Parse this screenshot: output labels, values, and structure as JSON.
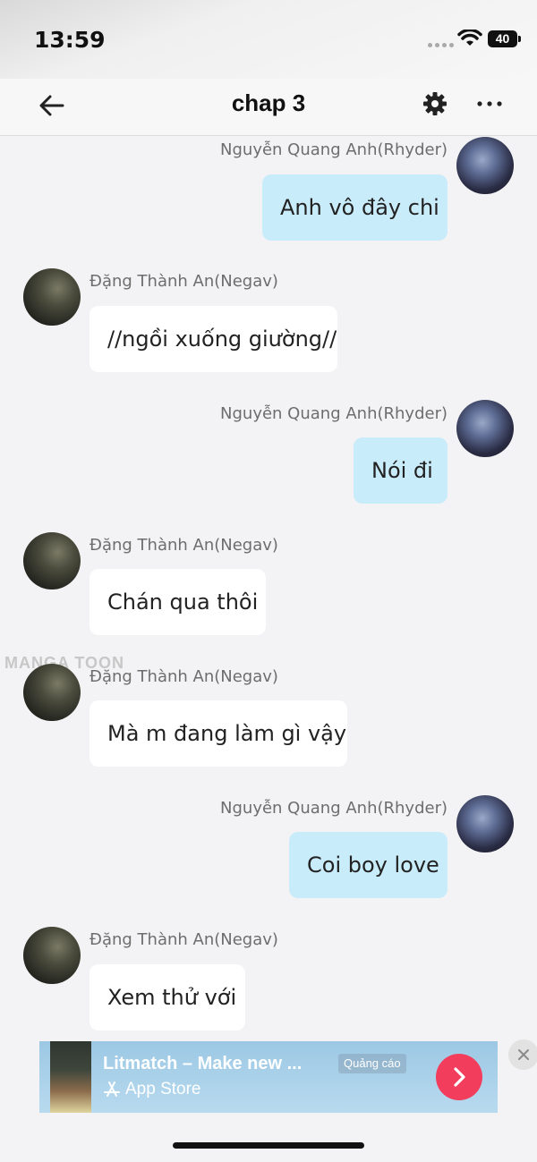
{
  "status_bar": {
    "time": "13:59",
    "battery": "40"
  },
  "header": {
    "title": "chap 3"
  },
  "watermark": "MANGA TOON",
  "messages": [
    {
      "sender": "Nguyễn Quang Anh(Rhyder)",
      "text": "Anh vô đây chi",
      "side": "right"
    },
    {
      "sender": "Đặng Thành An(Negav)",
      "text": "//ngồi xuống giường//",
      "side": "left"
    },
    {
      "sender": "Nguyễn Quang Anh(Rhyder)",
      "text": "Nói đi",
      "side": "right"
    },
    {
      "sender": "Đặng Thành An(Negav)",
      "text": "Chán qua thôi",
      "side": "left"
    },
    {
      "sender": "Đặng Thành An(Negav)",
      "text": "Mà m đang làm gì vậy",
      "side": "left"
    },
    {
      "sender": "Nguyễn Quang Anh(Rhyder)",
      "text": "Coi boy love",
      "side": "right"
    },
    {
      "sender": "Đặng Thành An(Negav)",
      "text": "Xem thử với",
      "side": "left"
    }
  ],
  "ad": {
    "title": "Litmatch – Make new ...",
    "badge": "Quảng cáo",
    "store": "App Store"
  },
  "colors": {
    "my_bubble": "#c9ecfb",
    "their_bubble": "#ffffff",
    "ad_cta": "#f23d5c"
  }
}
